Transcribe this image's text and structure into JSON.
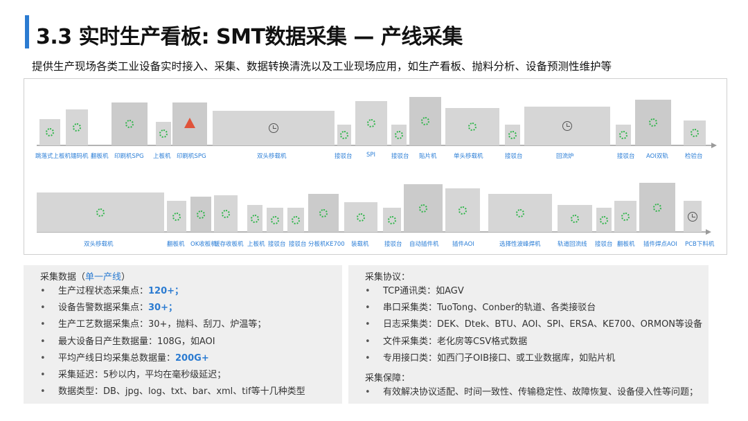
{
  "header": {
    "title": "3.3 实时生产看板: SMT数据采集 — 产线采集",
    "subtitle": "提供生产现场各类工业设备实时接入、采集、数据转换清洗以及工业现场应用，如生产看板、抛料分析、设备预测性维护等",
    "accent_color": "#2b7bd1"
  },
  "diagram": {
    "row1_labels": [
      "跳落式上板机镭码机",
      "翻板机",
      "印刷机SPG",
      "上板机",
      "印刷机SPG",
      "双头移载机",
      "接驳台",
      "SPI",
      "接驳台",
      "贴片机",
      "单头移载机",
      "接驳台",
      "回流炉",
      "接驳台",
      "AOI双轨",
      "检验台"
    ],
    "row2_labels": [
      "双头移载机",
      "翻板机",
      "OK收板机",
      "缓存收板机",
      "上板机",
      "接驳台",
      "接驳台",
      "分板机KE700",
      "装载机",
      "接驳台",
      "自动插件机",
      "插件AOI",
      "选择性波峰焊机",
      "轨道回流线",
      "接驳台",
      "翻板机",
      "插件焊点AOI",
      "PCB下料机"
    ],
    "status_colors": {
      "ok": "#2fb54a",
      "alarm": "#e0533a",
      "idle": "#555555"
    }
  },
  "left_panel": {
    "heading_prefix": "采集数据（",
    "heading_highlight": "单一产线",
    "heading_suffix": "）",
    "items": [
      {
        "text": "生产过程状态采集点：",
        "value": "120+；"
      },
      {
        "text": "设备告警数据采集点：",
        "value": "30+；"
      },
      {
        "text": "生产工艺数据采集点：30+，抛料、刮刀、炉温等；",
        "value": ""
      },
      {
        "text": "最大设备日产生数据量：108G，如AOI",
        "value": ""
      },
      {
        "text": "平均产线日均采集总数据量：",
        "value": "200G+"
      },
      {
        "text": "采集延迟：5秒以内，平均在毫秒级延迟；",
        "value": ""
      },
      {
        "text": "数据类型：DB、jpg、log、txt、bar、xml、tif等十几种类型",
        "value": ""
      }
    ]
  },
  "right_panel": {
    "heading": "采集协议：",
    "items": [
      {
        "text": "TCP通讯类：如AGV"
      },
      {
        "text": "串口采集类：TuoTong、Conber的轨道、各类接驳台"
      },
      {
        "text": "日志采集类：DEK、Dtek、BTU、AOI、SPI、ERSA、KE700、ORMON等设备"
      },
      {
        "text": "文件采集类：老化房等CSV格式数据"
      },
      {
        "text": "专用接口类：如西门子OIB接口、或工业数据库，如贴片机"
      }
    ],
    "sub_heading": "采集保障：",
    "sub_items": [
      {
        "text": "有效解决协议适配、时间一致性、传输稳定性、故障恢复、设备侵入性等问题；"
      }
    ]
  },
  "bullet_char": "•"
}
